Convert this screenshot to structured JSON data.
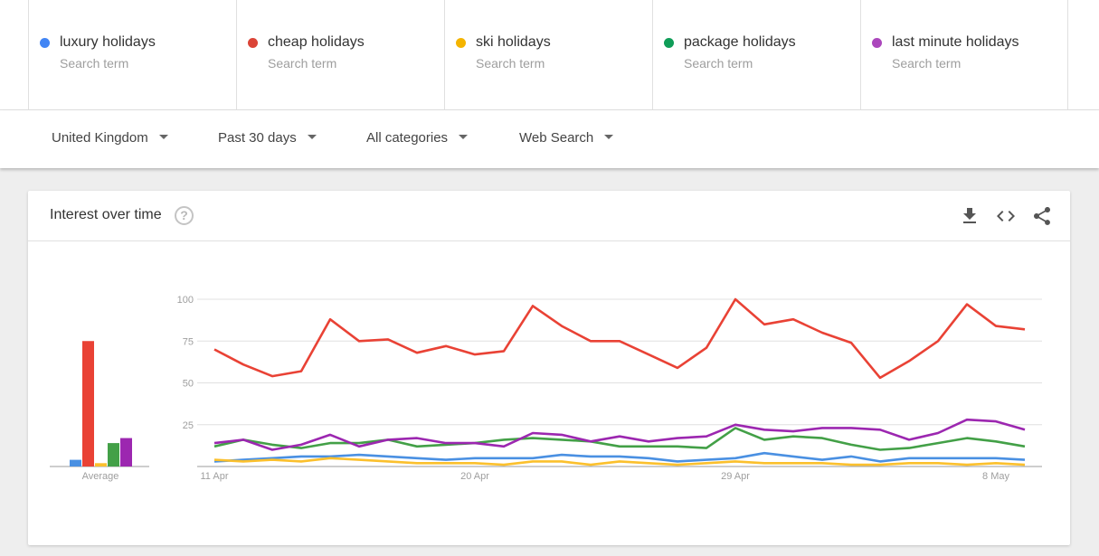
{
  "terms": [
    {
      "name": "luxury holidays",
      "sub": "Search term",
      "color": "#4285f4"
    },
    {
      "name": "cheap holidays",
      "sub": "Search term",
      "color": "#db4437"
    },
    {
      "name": "ski holidays",
      "sub": "Search term",
      "color": "#f4b400"
    },
    {
      "name": "package holidays",
      "sub": "Search term",
      "color": "#0f9d58"
    },
    {
      "name": "last minute holidays",
      "sub": "Search term",
      "color": "#ab47bc"
    }
  ],
  "filters": {
    "region": "United Kingdom",
    "time": "Past 30 days",
    "category": "All categories",
    "search_type": "Web Search"
  },
  "card": {
    "title": "Interest over time",
    "help_glyph": "?",
    "icons": [
      "download-icon",
      "embed-icon",
      "share-icon"
    ]
  },
  "chart_data": {
    "type": "line",
    "title": "Interest over time",
    "xlabel": "",
    "ylabel": "",
    "ylim": [
      0,
      100
    ],
    "yticks": [
      25,
      50,
      75,
      100
    ],
    "grid": true,
    "x": [
      "11 Apr",
      "12 Apr",
      "13 Apr",
      "14 Apr",
      "15 Apr",
      "16 Apr",
      "17 Apr",
      "18 Apr",
      "19 Apr",
      "20 Apr",
      "21 Apr",
      "22 Apr",
      "23 Apr",
      "24 Apr",
      "25 Apr",
      "26 Apr",
      "27 Apr",
      "28 Apr",
      "29 Apr",
      "30 Apr",
      "1 May",
      "2 May",
      "3 May",
      "4 May",
      "5 May",
      "6 May",
      "7 May",
      "8 May",
      "9 May"
    ],
    "xtick_labels": [
      {
        "label": "11 Apr",
        "index": 0
      },
      {
        "label": "20 Apr",
        "index": 9
      },
      {
        "label": "29 Apr",
        "index": 18
      },
      {
        "label": "8 May",
        "index": 27
      }
    ],
    "series": [
      {
        "name": "luxury holidays",
        "color": "#4a90e2",
        "values": [
          3,
          4,
          5,
          6,
          6,
          7,
          6,
          5,
          4,
          5,
          5,
          5,
          7,
          6,
          6,
          5,
          3,
          4,
          5,
          8,
          6,
          4,
          6,
          3,
          5,
          5,
          5,
          5,
          4
        ]
      },
      {
        "name": "cheap holidays",
        "color": "#e94235",
        "values": [
          70,
          61,
          54,
          57,
          88,
          75,
          76,
          68,
          72,
          67,
          69,
          96,
          84,
          75,
          75,
          67,
          59,
          71,
          100,
          85,
          88,
          80,
          74,
          53,
          63,
          75,
          97,
          84,
          82
        ]
      },
      {
        "name": "ski holidays",
        "color": "#fbc02d",
        "values": [
          4,
          3,
          4,
          3,
          5,
          4,
          3,
          2,
          2,
          2,
          1,
          3,
          3,
          1,
          3,
          2,
          1,
          2,
          3,
          2,
          2,
          2,
          1,
          1,
          2,
          2,
          1,
          2,
          1
        ]
      },
      {
        "name": "package holidays",
        "color": "#43a047",
        "values": [
          12,
          16,
          13,
          11,
          14,
          14,
          16,
          12,
          13,
          14,
          16,
          17,
          16,
          15,
          12,
          12,
          12,
          11,
          23,
          16,
          18,
          17,
          13,
          10,
          11,
          14,
          17,
          15,
          12
        ]
      },
      {
        "name": "last minute holidays",
        "color": "#9c27b0",
        "values": [
          14,
          16,
          10,
          13,
          19,
          12,
          16,
          17,
          14,
          14,
          12,
          20,
          19,
          15,
          18,
          15,
          17,
          18,
          25,
          22,
          21,
          23,
          23,
          22,
          16,
          20,
          28,
          27,
          22
        ]
      }
    ],
    "average": {
      "label": "Average",
      "values": [
        {
          "name": "luxury holidays",
          "value": 4,
          "color": "#4a90e2"
        },
        {
          "name": "cheap holidays",
          "value": 75,
          "color": "#e94235"
        },
        {
          "name": "ski holidays",
          "value": 2,
          "color": "#fbc02d"
        },
        {
          "name": "package holidays",
          "value": 14,
          "color": "#43a047"
        },
        {
          "name": "last minute holidays",
          "value": 17,
          "color": "#9c27b0"
        }
      ]
    }
  }
}
